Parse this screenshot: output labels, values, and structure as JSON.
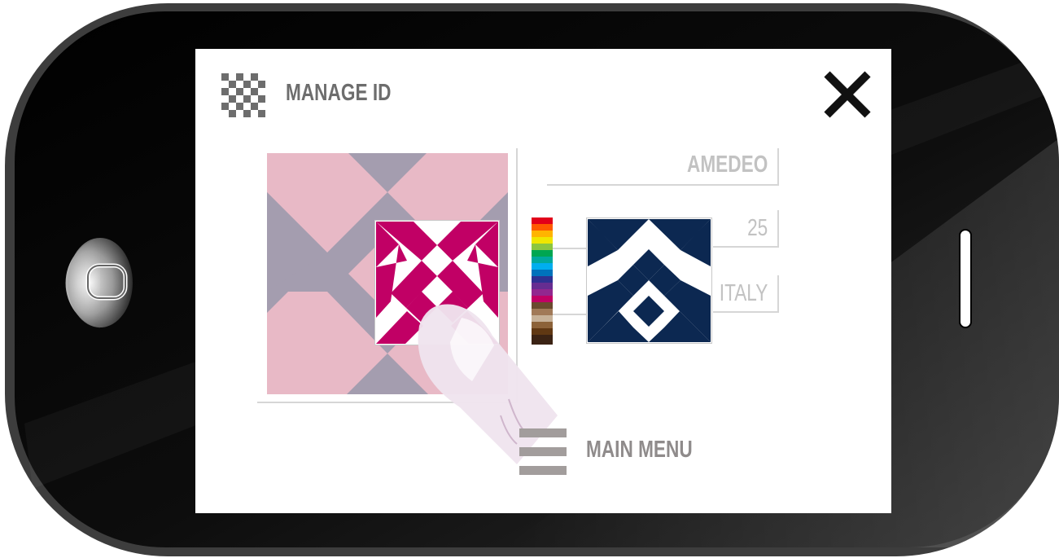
{
  "screen": {
    "title": "MANAGE ID",
    "fields": {
      "name": "AMEDEO",
      "age": "25",
      "country": "ITALY"
    },
    "menu_label": "MAIN MENU"
  },
  "colors": {
    "bezel": "#111111",
    "frame": "#3c3c3c",
    "pattern_large_bg": "#a49daf",
    "pattern_large_triangles": "#e8b9c6",
    "pattern_selected": "#c10065",
    "pattern_preview": "#0c2851",
    "text_gray": "#6d6d6d",
    "field_gray": "#c2c2c2"
  },
  "icons": {
    "title_icon": "checkerboard-icon",
    "close": "close-icon",
    "menu": "hamburger-menu-icon",
    "home": "home-button-icon"
  }
}
